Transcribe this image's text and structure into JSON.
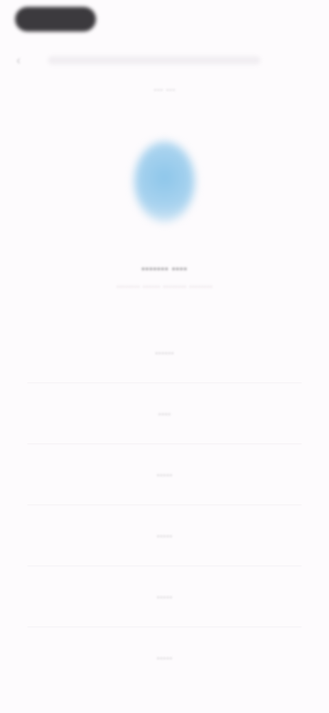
{
  "status_bar": {
    "pill_label": ""
  },
  "top": {
    "back_icon": "back-arrow-icon",
    "title_text": ""
  },
  "header": {
    "subtitle": "··· ···"
  },
  "hero": {
    "icon": "blue-circle-icon",
    "title": "······· ····",
    "description": "········ ······ ········ ········"
  },
  "options": [
    {
      "label": "······"
    },
    {
      "label": "····"
    },
    {
      "label": "·····"
    },
    {
      "label": "·····"
    },
    {
      "label": "·····"
    },
    {
      "label": "·····"
    }
  ],
  "colors": {
    "background": "#fdfbfd",
    "accent_circle": "#8dc6ea",
    "status_pill": "#3c3a3e"
  }
}
